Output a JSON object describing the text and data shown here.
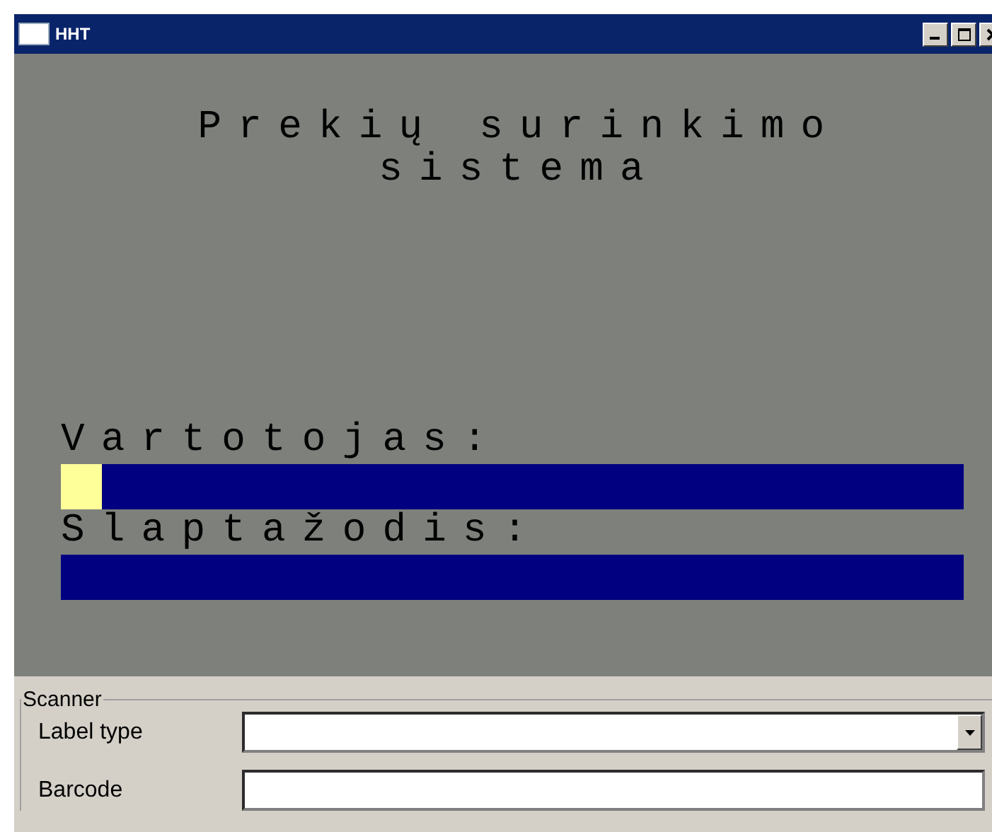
{
  "window": {
    "title": "HHT"
  },
  "terminal": {
    "heading": [
      "Prekių surinkimo",
      "sistema"
    ],
    "fields": [
      {
        "label": "Vartotojas:",
        "focused": true
      },
      {
        "label": "Slaptažodis:",
        "focused": false
      }
    ]
  },
  "scanner": {
    "title": "Scanner",
    "rows": [
      {
        "label": "Label type",
        "kind": "dropdown"
      },
      {
        "label": "Barcode",
        "kind": "text"
      }
    ]
  }
}
